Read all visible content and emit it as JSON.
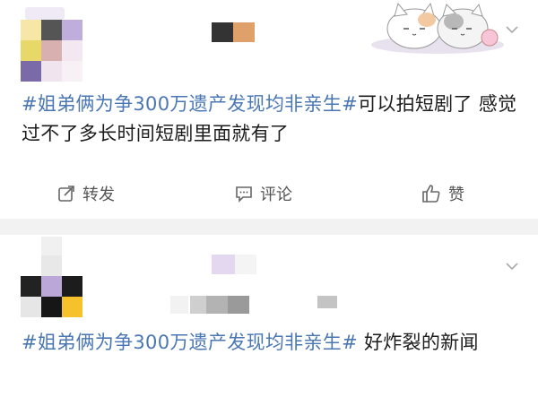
{
  "posts": [
    {
      "content": {
        "hashtag": "#姐弟俩为争300万遗产发现均非亲生#",
        "text": "可以拍短剧了 感觉过不了多长时间短剧里面就有了"
      },
      "actions": {
        "repost": "转发",
        "comment": "评论",
        "like": "赞"
      }
    },
    {
      "content": {
        "hashtag": "#姐弟俩为争300万遗产发现均非亲生#",
        "text": " 好炸裂的新闻"
      }
    }
  ],
  "icons": [
    "chevron-down-icon",
    "share-icon",
    "comment-icon",
    "thumbs-up-icon"
  ],
  "colors": {
    "hashtag": "#4a77b3",
    "separator": "#f2f2f2",
    "action_text": "#555555"
  }
}
